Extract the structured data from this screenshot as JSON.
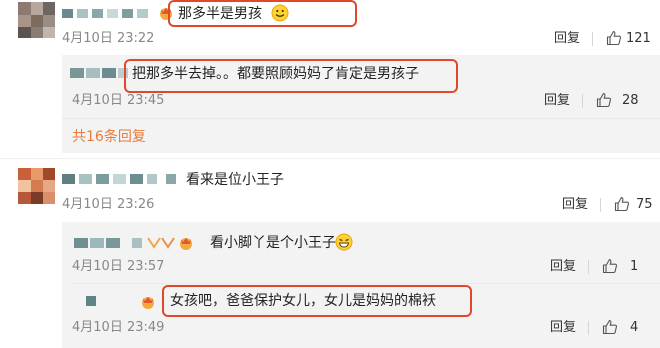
{
  "comments": [
    {
      "text": "那多半是男孩",
      "time": "4月10日 23:22",
      "reply_label": "回复",
      "likes": "121",
      "replies": [
        {
          "text": "把那多半去掉。。都要照顾妈妈了肯定是男孩子",
          "time": "4月10日 23:45",
          "reply_label": "回复",
          "likes": "28"
        }
      ],
      "more_replies": "共16条回复"
    },
    {
      "text": "看来是位小王子",
      "time": "4月10日 23:26",
      "reply_label": "回复",
      "likes": "75",
      "replies": [
        {
          "text": "看小脚丫是个小王子",
          "time": "4月10日 23:57",
          "reply_label": "回复",
          "likes": "1"
        },
        {
          "text": "女孩吧，爸爸保护女儿，女儿是妈妈的棉袄",
          "time": "4月10日 23:49",
          "reply_label": "回复",
          "likes": "4"
        }
      ]
    }
  ],
  "icons": {
    "like": "thumbs-up-icon",
    "emoji": "grin-face-icon",
    "badge": "vip-crown-icon"
  },
  "colors": {
    "highlight": "#e0482b",
    "more_link": "#ea7a3a",
    "timestamp": "#888888"
  }
}
